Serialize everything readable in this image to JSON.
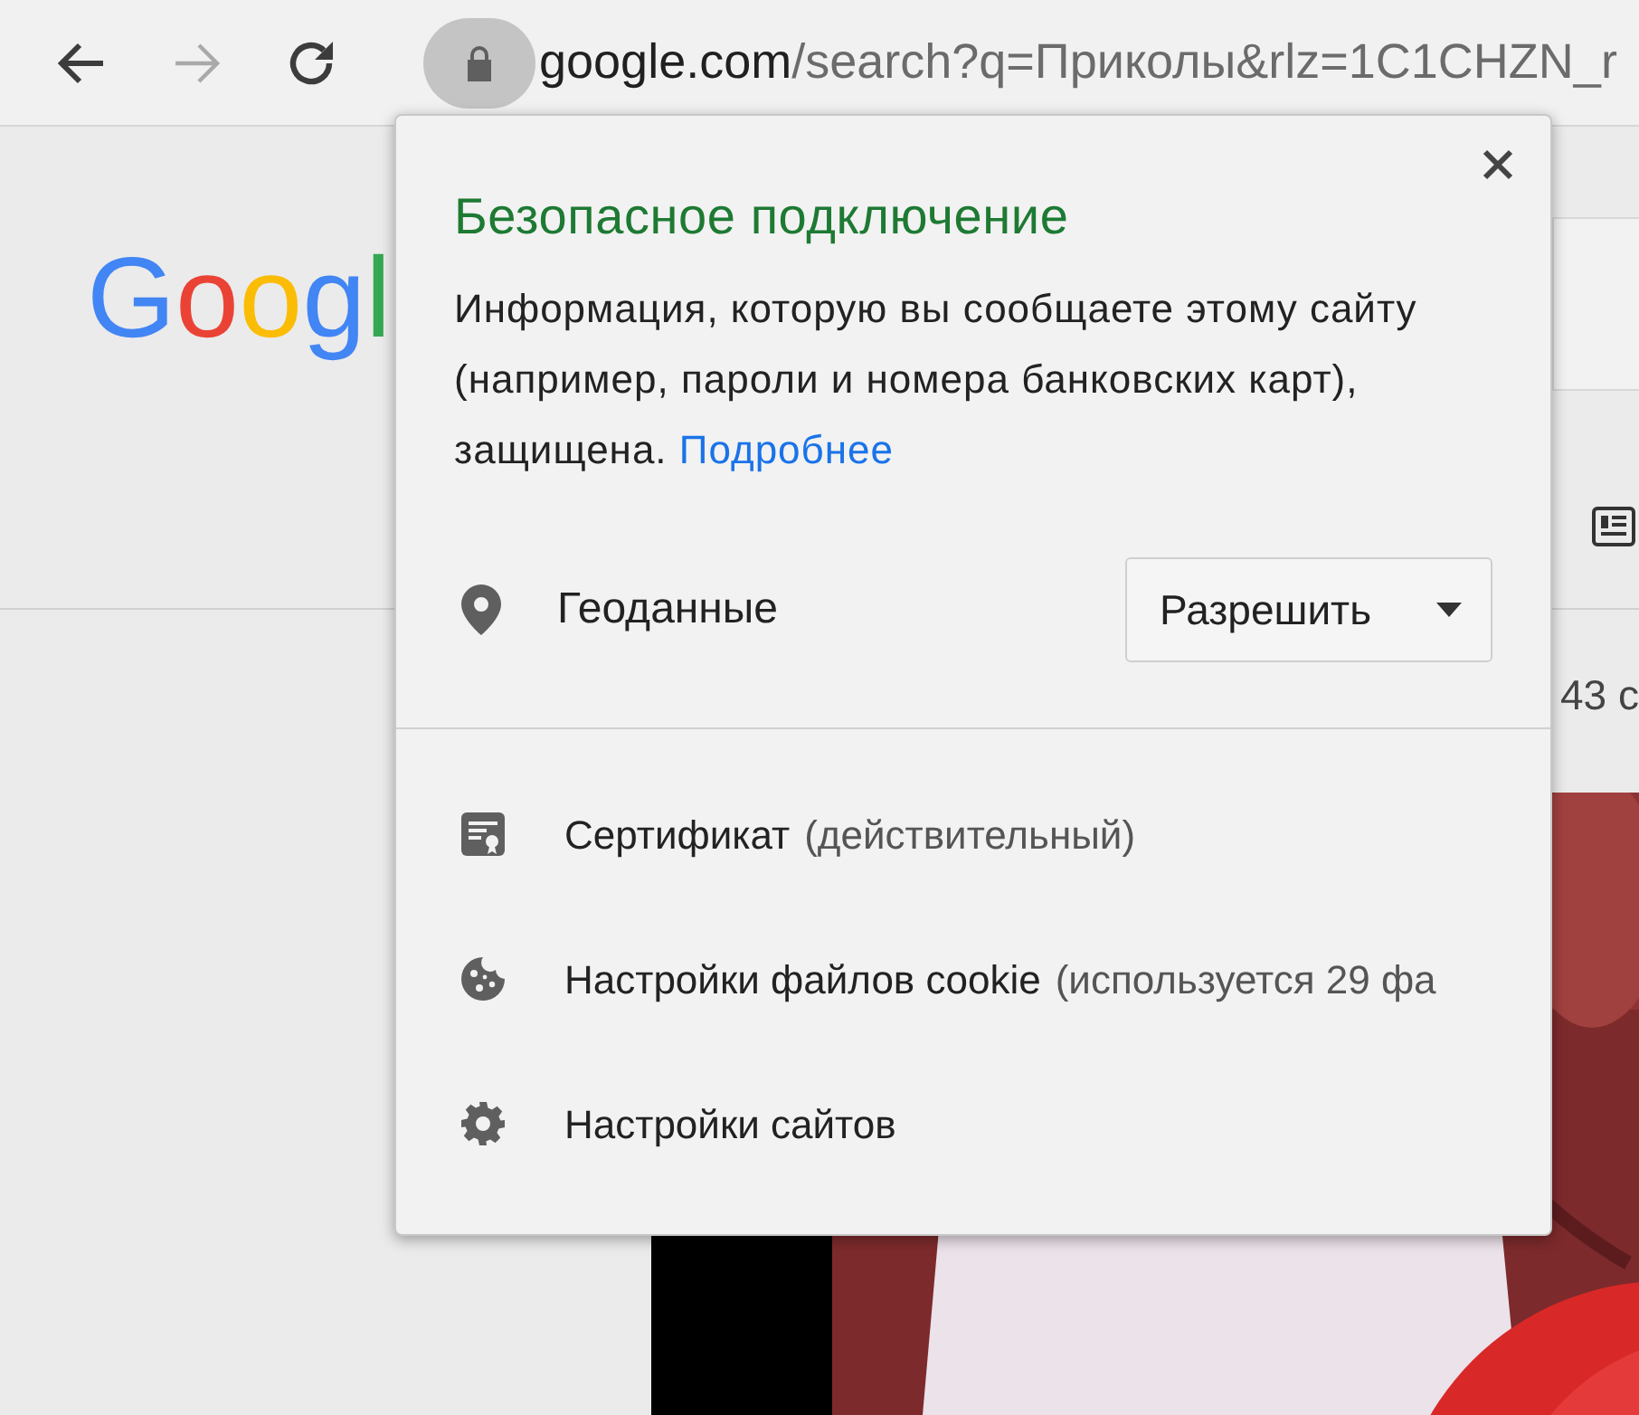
{
  "toolbar": {
    "nav_buttons": [
      {
        "kind": "back",
        "disabled": false
      },
      {
        "kind": "forward",
        "disabled": true
      },
      {
        "kind": "reload",
        "disabled": false
      }
    ],
    "address": {
      "host": "google.com",
      "path": "/search?q=Приколы&rlz=1C1CHZN_r"
    }
  },
  "page": {
    "logo_text": "Googl",
    "result_stats": "43 с"
  },
  "site_info_popup": {
    "title": "Безопасное подключение",
    "description": "Информация, которую вы сообщаете этому сайту (например, пароли и номера банковских карт), защищена.",
    "link": "Подробнее",
    "permission": {
      "label": "Геоданные",
      "value": "Разрешить"
    },
    "items": [
      {
        "kind": "certificate",
        "label": "Сертификат",
        "detail": "(действительный)"
      },
      {
        "kind": "cookies",
        "label": "Настройки файлов cookie",
        "detail": "(используется 29 фа"
      },
      {
        "kind": "settings",
        "label": "Настройки сайтов"
      }
    ]
  }
}
